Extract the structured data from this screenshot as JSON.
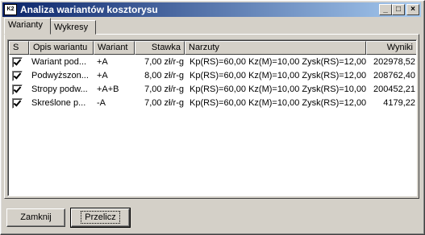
{
  "window": {
    "title": "Analiza wariantów kosztorysu",
    "app_icon_text": "K2"
  },
  "titlebar_buttons": {
    "minimize": "_",
    "maximize": "□",
    "close": "×"
  },
  "tabs": [
    {
      "label": "Warianty"
    },
    {
      "label": "Wykresy"
    }
  ],
  "columns": {
    "s": "S",
    "opis": "Opis wariantu",
    "wariant": "Wariant",
    "stawka": "Stawka",
    "narzuty": "Narzuty",
    "wyniki": "Wyniki"
  },
  "rows": [
    {
      "checked": true,
      "opis": "Wariant pod...",
      "wariant": "+A",
      "stawka": "7,00 zł/r-g",
      "narzuty": "Kp(RS)=60,00 Kz(M)=10,00 Zysk(RS)=12,00",
      "wyniki": "202978,52"
    },
    {
      "checked": true,
      "opis": "Podwyższon...",
      "wariant": "+A",
      "stawka": "8,00 zł/r-g",
      "narzuty": "Kp(RS)=60,00 Kz(M)=10,00 Zysk(RS)=12,00",
      "wyniki": "208762,40"
    },
    {
      "checked": true,
      "opis": "Stropy podw...",
      "wariant": "+A+B",
      "stawka": "7,00 zł/r-g",
      "narzuty": "Kp(RS)=60,00 Kz(M)=10,00 Zysk(RS)=10,00",
      "wyniki": "200452,21"
    },
    {
      "checked": true,
      "opis": "Skreślone p...",
      "wariant": "-A",
      "stawka": "7,00 zł/r-g",
      "narzuty": "Kp(RS)=60,00 Kz(M)=10,00 Zysk(RS)=12,00",
      "wyniki": "4179,22"
    }
  ],
  "buttons": {
    "close": "Zamknij",
    "recalculate": "Przelicz"
  }
}
